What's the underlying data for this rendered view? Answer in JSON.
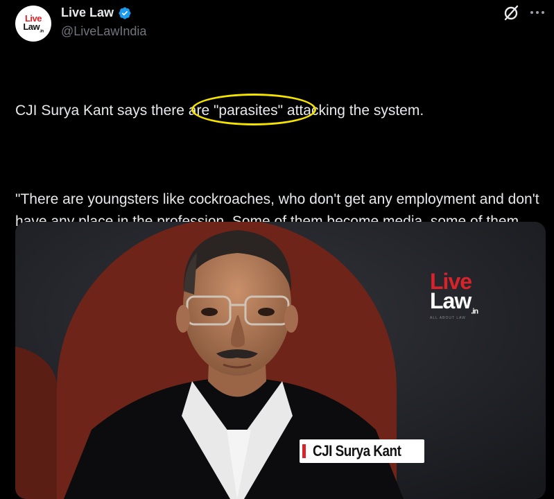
{
  "author": {
    "display_name": "Live Law",
    "handle": "@LiveLawIndia",
    "avatar_text_line1": "Live",
    "avatar_text_line2": "Law",
    "avatar_text_suffix": ".in",
    "verified": true
  },
  "tweet": {
    "paragraphs": [
      "CJI Surya Kant says there are \"parasites\" attacking the system.",
      "\"There are youngsters like cockroaches, who don't get any employment and don't have any place in the profession. Some of them become media, some of them become social media, some of them become RTI activists, some of them become other activists, and they start attacking everyone.\" - CJI."
    ],
    "highlighted_word": "cockroaches,"
  },
  "media": {
    "caption": "CJI Surya Kant",
    "logo_line1": "Live",
    "logo_line2": "Law",
    "logo_suffix": ".in",
    "logo_tagline": "ALL ABOUT LAW"
  },
  "icons": {
    "top_right": [
      "grok-icon",
      "more-icon"
    ]
  },
  "colors": {
    "background": "#000000",
    "text": "#e7e9ea",
    "muted": "#71767b",
    "verified": "#1d9bf0",
    "highlight": "#f4e400",
    "brand_red": "#d8232a"
  }
}
